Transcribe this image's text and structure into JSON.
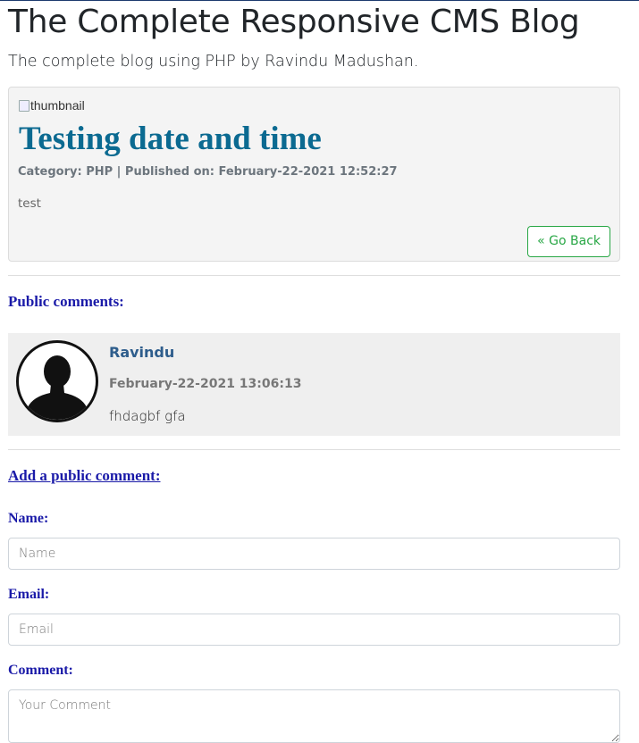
{
  "site": {
    "title": "The Complete Responsive CMS Blog",
    "subtitle": "The complete blog using PHP by Ravindu Madushan."
  },
  "post": {
    "thumbnail_alt": "thumbnail",
    "title": "Testing date and time",
    "meta": "Category: PHP | Published on: February-22-2021 12:52:27",
    "body": "test",
    "back_label": "« Go Back"
  },
  "comments": {
    "heading": "Public comments:",
    "items": [
      {
        "author": "Ravindu",
        "date": "February-22-2021 13:06:13",
        "text": "fhdagbf gfa"
      }
    ]
  },
  "form": {
    "heading": "Add a public comment:",
    "name_label": "Name:",
    "name_placeholder": "Name",
    "email_label": "Email:",
    "email_placeholder": "Email",
    "comment_label": "Comment:",
    "comment_placeholder": "Your Comment"
  },
  "colors": {
    "post_title": "#0b6a91",
    "section_heading": "#1a1aa8",
    "back_button": "#28a745"
  }
}
